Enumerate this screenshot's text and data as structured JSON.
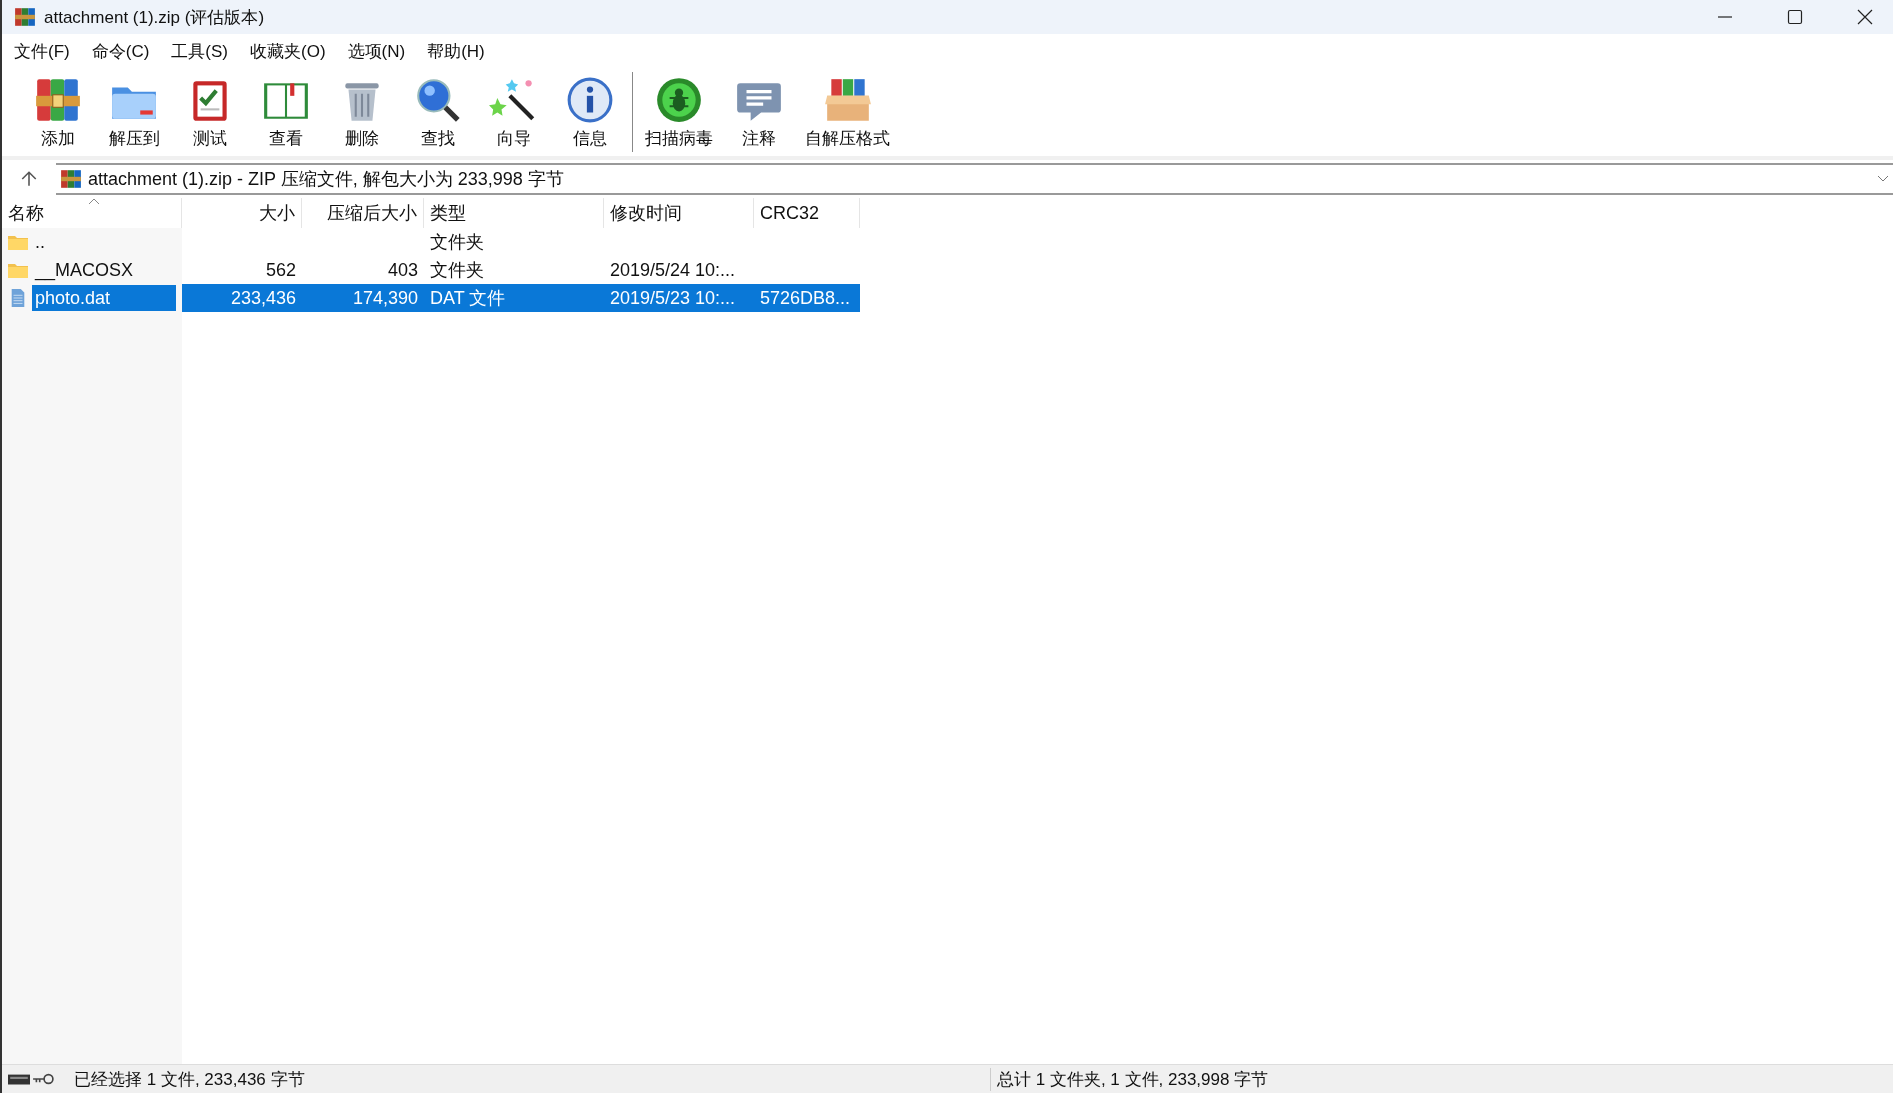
{
  "window": {
    "title": "attachment (1).zip (评估版本)"
  },
  "menu": [
    "文件(F)",
    "命令(C)",
    "工具(S)",
    "收藏夹(O)",
    "选项(N)",
    "帮助(H)"
  ],
  "toolbar": {
    "groups": [
      [
        "添加",
        "解压到",
        "测试",
        "查看",
        "删除",
        "查找",
        "向导",
        "信息"
      ],
      [
        "扫描病毒",
        "注释",
        "自解压格式"
      ]
    ]
  },
  "address": {
    "value": "attachment (1).zip - ZIP 压缩文件, 解包大小为 233,998 字节"
  },
  "table": {
    "columns": [
      "名称",
      "大小",
      "压缩后大小",
      "类型",
      "修改时间",
      "CRC32"
    ],
    "rows": [
      {
        "kind": "folder",
        "name": "..",
        "size": "",
        "packed": "",
        "type": "文件夹",
        "modified": "",
        "crc": "",
        "selected": false
      },
      {
        "kind": "folder",
        "name": "__MACOSX",
        "size": "562",
        "packed": "403",
        "type": "文件夹",
        "modified": "2019/5/24 10:...",
        "crc": "",
        "selected": false
      },
      {
        "kind": "file",
        "name": "photo.dat",
        "size": "233,436",
        "packed": "174,390",
        "type": "DAT 文件",
        "modified": "2019/5/23 10:...",
        "crc": "5726DB8...",
        "selected": true
      }
    ]
  },
  "status_bar": {
    "left": "已经选择 1 文件, 233,436 字节",
    "right": "总计 1 文件夹, 1 文件, 233,998 字节"
  }
}
